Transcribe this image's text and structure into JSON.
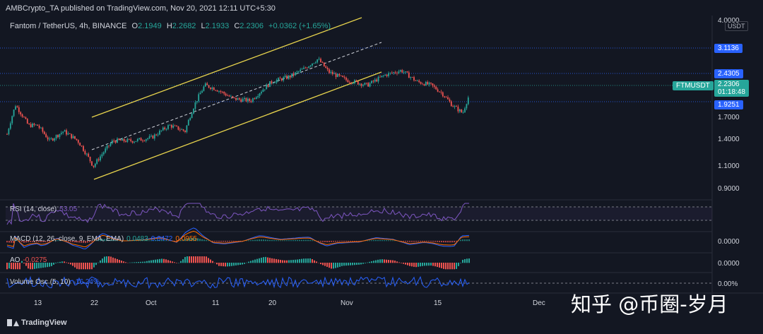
{
  "header": {
    "published": "AMBCrypto_TA published on TradingView.com, Nov 20, 2021 12:11 UTC+5:30",
    "symbol": "Fantom / TetherUS, 4h, BINANCE",
    "open_label": "O",
    "open": "2.1949",
    "high_label": "H",
    "high": "2.2682",
    "low_label": "L",
    "low": "2.1933",
    "close_label": "C",
    "close": "2.2306",
    "change": "+0.0362 (+1.65%)"
  },
  "price_axis": {
    "unit": "USDT",
    "ticks": [
      "4.0000",
      "1.7000",
      "1.4000",
      "1.1000",
      "0.9000"
    ],
    "badges": {
      "level_1": "3.1136",
      "level_2": "2.4305",
      "ticker": "FTMUSDT",
      "last": "2.2306",
      "countdown": "01:18:48",
      "level_3": "1.9251"
    }
  },
  "time_axis": [
    "13",
    "22",
    "Oct",
    "11",
    "20",
    "Nov",
    "15",
    "Dec"
  ],
  "indicators": {
    "rsi": {
      "label": "RSI (14, close)",
      "value": "53.05"
    },
    "macd": {
      "label": "MACD (12, 26, close, 9, EMA, EMA)",
      "v1": "0.0483",
      "v2": "0.0472",
      "v3": "0.0955",
      "axis": "0.0000"
    },
    "ao": {
      "label": "AO",
      "value": "-0.0275",
      "axis": "0.0000"
    },
    "vol": {
      "label": "Volume Osc (5, 10)",
      "value": "-16.24%",
      "axis": "0.00%"
    }
  },
  "footer": {
    "brand": "TradingView"
  },
  "watermark": "知乎 @币圈-岁月",
  "colors": {
    "bg": "#131722",
    "up": "#26a69a",
    "down": "#ef5350",
    "channel": "#e8d44d",
    "rsi": "#7e57c2",
    "volosc": "#2962ff",
    "badge_blue": "#2962ff",
    "badge_green": "#26a69a"
  },
  "chart_data": {
    "type": "candlestick",
    "interval": "4h",
    "x_ticks": [
      "13",
      "22",
      "Oct",
      "11",
      "20",
      "Nov",
      "15",
      "Dec"
    ],
    "price_path": [
      [
        "13",
        1.55
      ],
      [
        "22",
        0.97
      ],
      [
        "Oct",
        1.35
      ],
      [
        "11",
        2.35
      ],
      [
        "20",
        3.1
      ],
      [
        "Nov",
        2.55
      ],
      [
        "15",
        1.78
      ],
      [
        "end",
        2.2306
      ]
    ],
    "channel": {
      "upper": "yellow",
      "lower": "yellow",
      "mid": "dashed white"
    },
    "rsi_last": 53.05,
    "horizontal_levels": [
      3.1136,
      2.4305,
      1.9251
    ]
  }
}
